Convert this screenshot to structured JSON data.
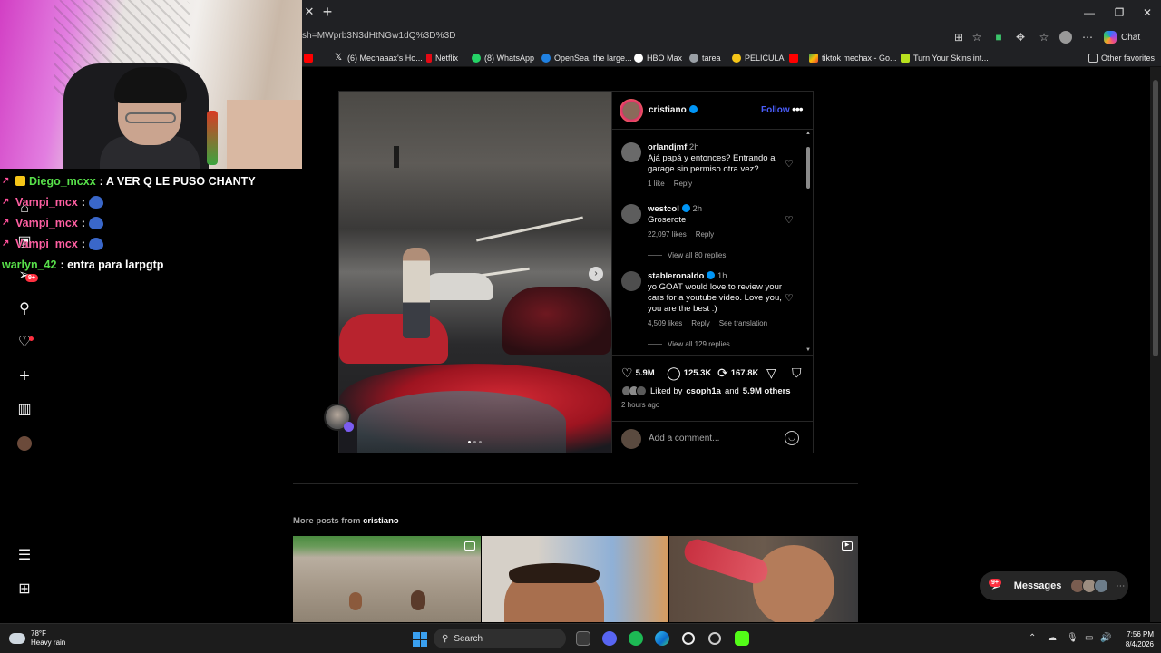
{
  "browser": {
    "url": "sh=MWprb3N3dHtNGw1dQ%3D%3D",
    "chat_label": "Chat",
    "favorites": [
      {
        "label": "(6) Mechaaax's Ho...",
        "color": "#ffffff"
      },
      {
        "label": "Netflix",
        "color": "#e50914"
      },
      {
        "label": "(8) WhatsApp",
        "color": "#25d366"
      },
      {
        "label": "OpenSea, the large...",
        "color": "#2081e2"
      },
      {
        "label": "HBO Max",
        "color": "#ffffff"
      },
      {
        "label": "tarea",
        "color": "#9aa0a6"
      },
      {
        "label": "PELICULA",
        "color": "#f5c518"
      },
      {
        "label": "tiktok mechax - Go...",
        "color": "#34a853"
      },
      {
        "label": "Turn Your Skins int...",
        "color": "#b8e11e"
      }
    ],
    "other_favorites": "Other favorites"
  },
  "stream_chat": [
    {
      "user": "Diego_mcxx",
      "message": ": A VER Q LE PUSO CHANTY",
      "color": "#58e04a"
    },
    {
      "user": "Vampi_mcx",
      "message": ":",
      "color": "#ff5fa2"
    },
    {
      "user": "Vampi_mcx",
      "message": ":",
      "color": "#ff5fa2"
    },
    {
      "user": "Vampi_mcx",
      "message": ":",
      "color": "#ff5fa2"
    },
    {
      "user": "warlyn_42",
      "message": ": entra para larpgtp",
      "color": "#58e04a"
    }
  ],
  "nav": {
    "notifications_badge": "9+"
  },
  "post": {
    "username": "cristiano",
    "follow_label": "Follow",
    "comments": [
      {
        "user": "orlandjmf",
        "time": "2h",
        "text": "Ajá papá y entonces? Entrando al garage sin permiso otra vez?...",
        "likes": "1 like",
        "reply": "Reply",
        "verified": false
      },
      {
        "user": "westcol",
        "time": "2h",
        "text": "Groserote",
        "likes": "22,097 likes",
        "reply": "Reply",
        "verified": true
      },
      {
        "user": "stableronaldo",
        "time": "1h",
        "text": "yo GOAT would love to review your cars for a youtube video. Love you, you are the best :)",
        "likes": "4,509 likes",
        "reply": "Reply",
        "translation": "See translation",
        "verified": true
      }
    ],
    "view_replies": [
      "View all 80 replies",
      "View all 129 replies"
    ],
    "likes_count": "5.9M",
    "comments_count": "125.3K",
    "reposts_count": "167.8K",
    "liked_by_prefix": "Liked by",
    "liked_by_user": "csoph1a",
    "liked_by_and": "and",
    "liked_by_others": "5.9M others",
    "time_ago": "2 hours ago",
    "add_comment_placeholder": "Add a comment..."
  },
  "more_posts": {
    "prefix": "More posts from",
    "user": "cristiano"
  },
  "messages": {
    "label": "Messages",
    "badge": "9+"
  },
  "taskbar": {
    "temperature": "78°F",
    "condition": "Heavy rain",
    "search_label": "Search",
    "time": "7:56 PM",
    "date": "8/4/2026"
  }
}
